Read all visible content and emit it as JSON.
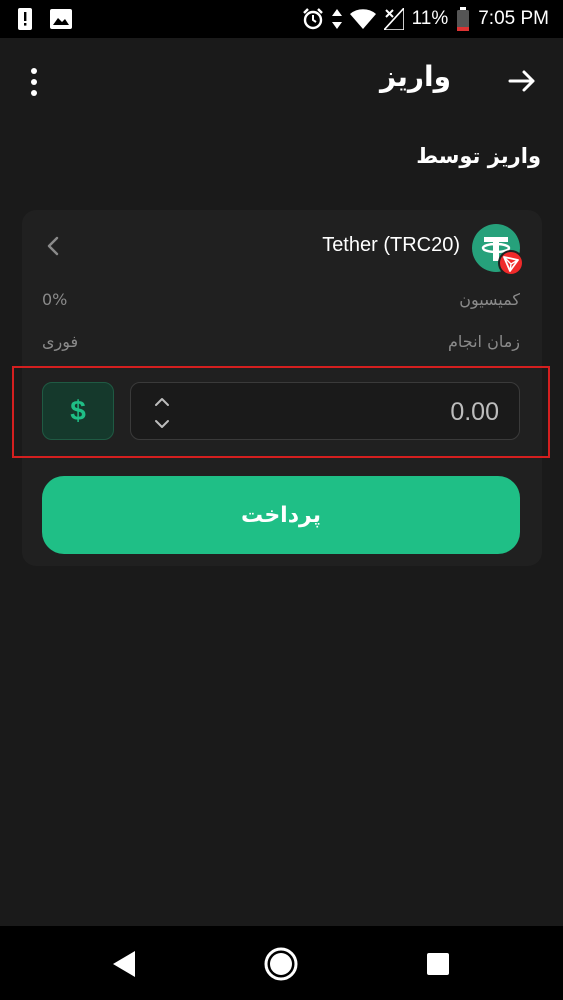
{
  "status_bar": {
    "battery_percent": "11%",
    "time": "7:05 PM",
    "icons": [
      "alert-icon",
      "image-icon",
      "alarm-icon",
      "data-arrows-icon",
      "wifi-icon",
      "no-signal-icon",
      "battery-icon"
    ]
  },
  "header": {
    "title": "واریز",
    "menu_icon": "more-vertical-icon",
    "back_icon": "arrow-right-icon"
  },
  "section": {
    "label": "واریز توسط"
  },
  "payment_method": {
    "name": "Tether (TRC20)",
    "logo": "tether-icon",
    "network_badge": "tron-icon",
    "fee_label": "کمیسیون",
    "fee_value": "0%",
    "time_label": "زمان انجام",
    "time_value": "فوری"
  },
  "amount": {
    "currency_symbol": "$",
    "placeholder": "0.00",
    "value": ""
  },
  "pay_button": {
    "label": "پرداخت"
  },
  "colors": {
    "background": "#1a1a1a",
    "card": "#202020",
    "accent": "#1fbf86",
    "highlight": "#d41f1f"
  }
}
